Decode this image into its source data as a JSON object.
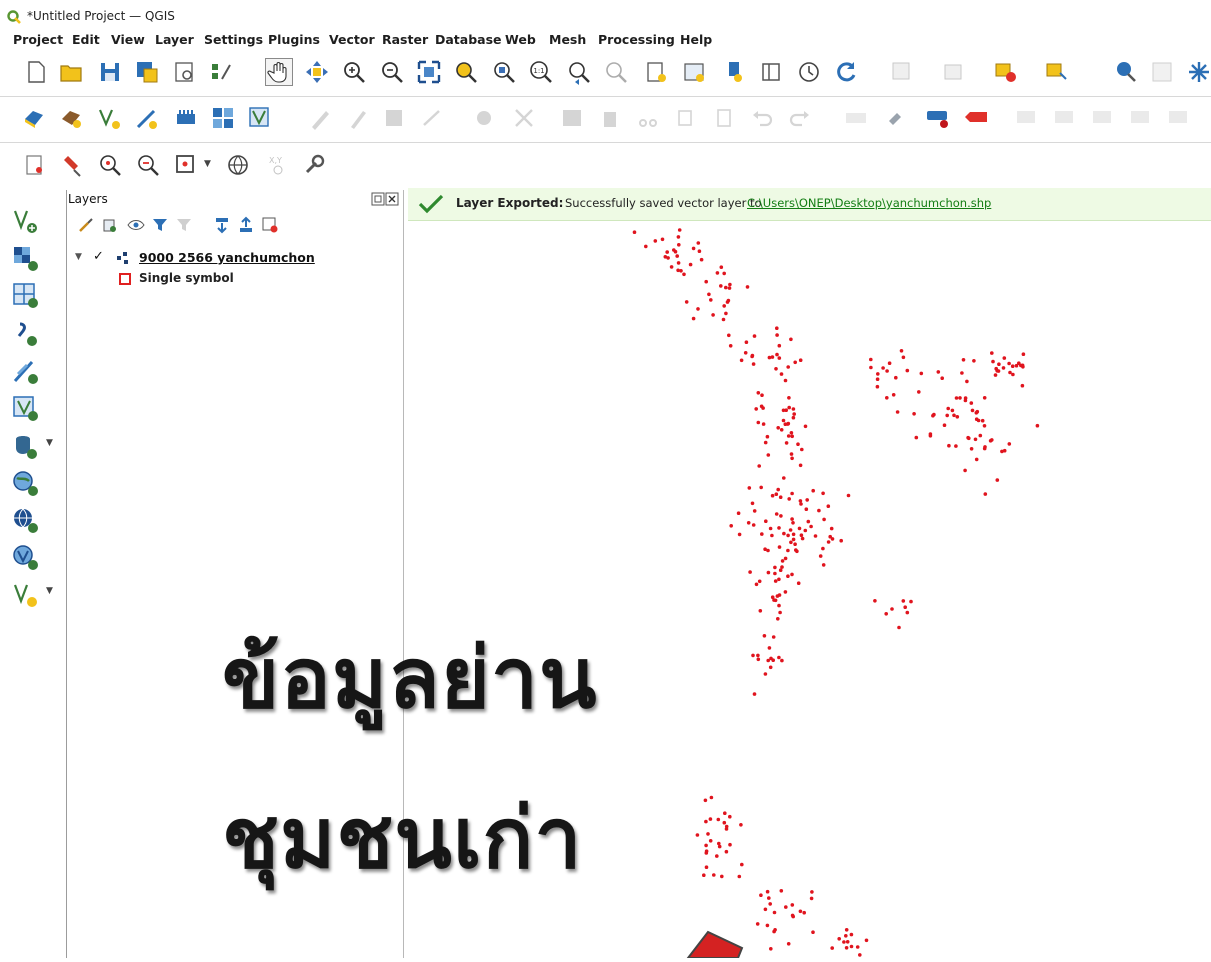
{
  "window": {
    "title": "*Untitled Project — QGIS"
  },
  "menu": [
    "Project",
    "Edit",
    "View",
    "Layer",
    "Settings",
    "Plugins",
    "Vector",
    "Raster",
    "Database",
    "Web",
    "Mesh",
    "Processing",
    "Help"
  ],
  "layers_panel": {
    "title": "Layers",
    "layer": {
      "name": "9000 2566 yanchumchon",
      "checked": "✓",
      "symbol": "Single symbol"
    }
  },
  "message": {
    "title": "Layer Exported:",
    "text": "Successfully saved vector layer to",
    "link": "C:\\Users\\ONEP\\Desktop\\yanchumchon.shp"
  },
  "overlay": {
    "line1": "ข้อมูลย่าน",
    "line2": "ชุมชนเก่า"
  },
  "colors": {
    "points": "#e0141e",
    "message_bg": "#eefae4",
    "link": "#137d13",
    "accent_yellow": "#f2c21b"
  },
  "icons": {
    "toolbar1": [
      "new-project-icon",
      "open-project-icon",
      "save-project-icon",
      "save-as-icon",
      "print-layout-icon",
      "layout-manager-icon",
      "pan-icon",
      "pan-to-selection-icon",
      "zoom-in-icon",
      "zoom-out-icon",
      "zoom-full-icon",
      "zoom-to-selection-icon",
      "zoom-to-layer-icon",
      "zoom-native-icon",
      "zoom-last-icon",
      "zoom-next-icon",
      "new-bookmark-icon",
      "show-bookmarks-icon",
      "new-map-view-icon",
      "temporal-controller-icon",
      "refresh-icon",
      "select-features-icon",
      "deselect-icon",
      "open-attribute-table-icon",
      "measure-icon",
      "identify-icon"
    ],
    "toolbar2": [
      "data-source-manager-icon",
      "new-geopackage-icon",
      "new-shapefile-icon",
      "digitize-icon",
      "new-temporary-layer-icon",
      "new-virtual-layer-icon",
      "new-spatialite-icon",
      "toggle-editing-icon",
      "current-edits-icon",
      "save-edits-icon",
      "add-feature-icon",
      "vertex-tool-icon",
      "delete-selected-icon",
      "cut-icon",
      "copy-icon",
      "paste-icon",
      "undo-icon",
      "redo-icon",
      "label-toolbar-icon",
      "pin-labels-icon",
      "show-labels-icon",
      "highlight-labels-icon",
      "move-label-icon",
      "rotate-label-icon",
      "change-label-icon"
    ],
    "toolbar3": [
      "georeferencer-icon",
      "pin-icon",
      "zoom-search-icon",
      "zoom-pan-icon",
      "select-rectangle-icon",
      "globe-icon",
      "coordinate-capture-icon",
      "settings-wrench-icon"
    ],
    "leftbar": [
      "add-vector-layer-icon",
      "add-raster-layer-icon",
      "add-mesh-layer-icon",
      "add-delimited-text-icon",
      "add-spatialite-icon",
      "add-virtual-layer-icon",
      "add-postgis-icon",
      "add-wms-icon",
      "add-wfs-icon",
      "add-wcs-icon",
      "add-vector-tile-icon"
    ]
  }
}
